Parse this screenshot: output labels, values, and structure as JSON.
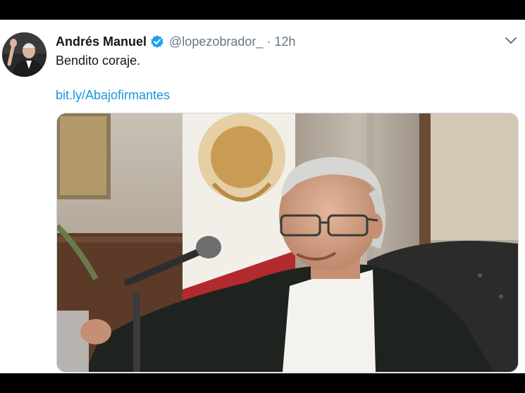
{
  "tweet": {
    "display_name": "Andrés Manuel",
    "handle": "@lopezobrador_",
    "separator": "·",
    "timestamp": "12h",
    "text": "Bendito coraje.",
    "link": "bit.ly/Abajofirmantes"
  },
  "icons": {
    "verified": "verified-badge-icon",
    "menu": "chevron-down-icon"
  },
  "colors": {
    "name": "#14171a",
    "secondary": "#657786",
    "link": "#1b95e0",
    "verified": "#1da1f2"
  }
}
